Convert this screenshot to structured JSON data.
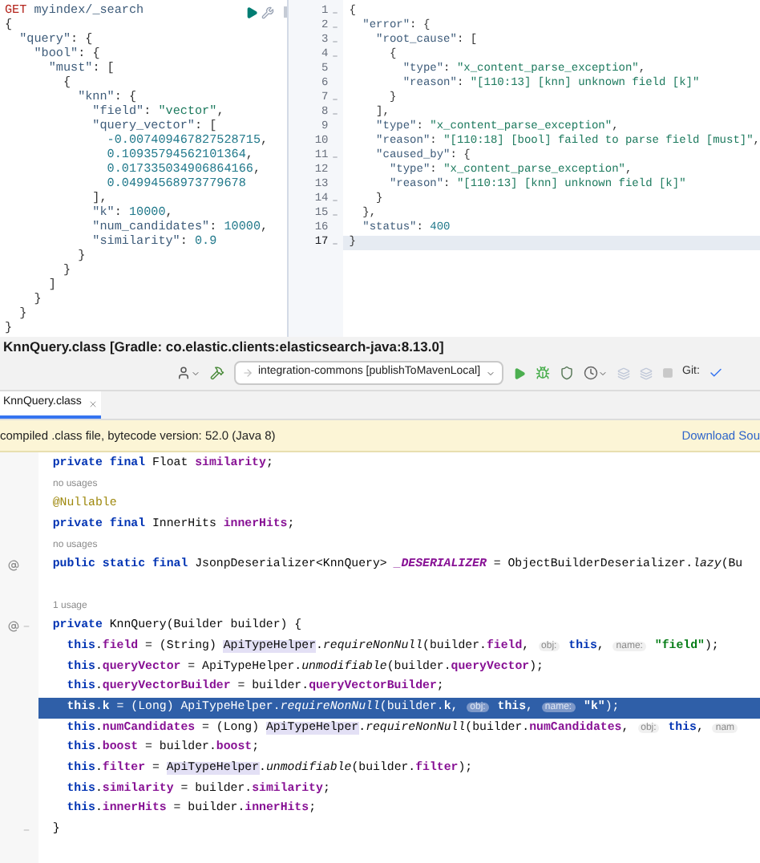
{
  "console": {
    "request": {
      "method": "GET",
      "path": "myindex/_search"
    },
    "request_body": [
      {
        "segments": [
          {
            "text": "{",
            "kind": "punct"
          }
        ]
      },
      {
        "segments": [
          {
            "text": "  \"query\"",
            "kind": "key"
          },
          {
            "text": ": {",
            "kind": "punct"
          }
        ]
      },
      {
        "segments": [
          {
            "text": "    \"bool\"",
            "kind": "key"
          },
          {
            "text": ": {",
            "kind": "punct"
          }
        ]
      },
      {
        "segments": [
          {
            "text": "      \"must\"",
            "kind": "key"
          },
          {
            "text": ": [",
            "kind": "punct"
          }
        ]
      },
      {
        "segments": [
          {
            "text": "        {",
            "kind": "punct"
          }
        ]
      },
      {
        "segments": [
          {
            "text": "          \"knn\"",
            "kind": "key"
          },
          {
            "text": ": {",
            "kind": "punct"
          }
        ]
      },
      {
        "segments": [
          {
            "text": "            \"field\"",
            "kind": "key"
          },
          {
            "text": ": ",
            "kind": "punct"
          },
          {
            "text": "\"vector\"",
            "kind": "string"
          },
          {
            "text": ",",
            "kind": "punct"
          }
        ]
      },
      {
        "segments": [
          {
            "text": "            \"query_vector\"",
            "kind": "key"
          },
          {
            "text": ": [",
            "kind": "punct"
          }
        ]
      },
      {
        "segments": [
          {
            "text": "              -0.007409467827528715",
            "kind": "number"
          },
          {
            "text": ",",
            "kind": "punct"
          }
        ]
      },
      {
        "segments": [
          {
            "text": "              0.10935794562101364",
            "kind": "number"
          },
          {
            "text": ",",
            "kind": "punct"
          }
        ]
      },
      {
        "segments": [
          {
            "text": "              0.017335034906864166",
            "kind": "number"
          },
          {
            "text": ",",
            "kind": "punct"
          }
        ]
      },
      {
        "segments": [
          {
            "text": "              0.04994568973779678",
            "kind": "number"
          }
        ]
      },
      {
        "segments": [
          {
            "text": "            ],",
            "kind": "punct"
          }
        ]
      },
      {
        "segments": [
          {
            "text": "            \"k\"",
            "kind": "key"
          },
          {
            "text": ": ",
            "kind": "punct"
          },
          {
            "text": "10000",
            "kind": "number"
          },
          {
            "text": ",",
            "kind": "punct"
          }
        ]
      },
      {
        "segments": [
          {
            "text": "            \"num_candidates\"",
            "kind": "key"
          },
          {
            "text": ": ",
            "kind": "punct"
          },
          {
            "text": "10000",
            "kind": "number"
          },
          {
            "text": ",",
            "kind": "punct"
          }
        ]
      },
      {
        "segments": [
          {
            "text": "            \"similarity\"",
            "kind": "key"
          },
          {
            "text": ": ",
            "kind": "punct"
          },
          {
            "text": "0.9",
            "kind": "number"
          }
        ]
      },
      {
        "segments": [
          {
            "text": "          }",
            "kind": "punct"
          }
        ]
      },
      {
        "segments": [
          {
            "text": "        }",
            "kind": "punct"
          }
        ]
      },
      {
        "segments": [
          {
            "text": "      ]",
            "kind": "punct"
          }
        ]
      },
      {
        "segments": [
          {
            "text": "    }",
            "kind": "punct"
          }
        ]
      },
      {
        "segments": [
          {
            "text": "  }",
            "kind": "punct"
          }
        ]
      },
      {
        "segments": [
          {
            "text": "}",
            "kind": "punct"
          }
        ]
      }
    ],
    "response": [
      {
        "number": "1",
        "foldable": true,
        "current": false,
        "segments": [
          {
            "text": "{",
            "kind": "punct"
          }
        ]
      },
      {
        "number": "2",
        "foldable": true,
        "current": false,
        "segments": [
          {
            "text": "  \"error\"",
            "kind": "key"
          },
          {
            "text": ": {",
            "kind": "punct"
          }
        ]
      },
      {
        "number": "3",
        "foldable": true,
        "current": false,
        "segments": [
          {
            "text": "    \"root_cause\"",
            "kind": "key"
          },
          {
            "text": ": [",
            "kind": "punct"
          }
        ]
      },
      {
        "number": "4",
        "foldable": true,
        "current": false,
        "segments": [
          {
            "text": "      {",
            "kind": "punct"
          }
        ]
      },
      {
        "number": "5",
        "foldable": false,
        "current": false,
        "segments": [
          {
            "text": "        \"type\"",
            "kind": "key"
          },
          {
            "text": ": ",
            "kind": "punct"
          },
          {
            "text": "\"x_content_parse_exception\"",
            "kind": "string"
          },
          {
            "text": ",",
            "kind": "punct"
          }
        ]
      },
      {
        "number": "6",
        "foldable": false,
        "current": false,
        "segments": [
          {
            "text": "        \"reason\"",
            "kind": "key"
          },
          {
            "text": ": ",
            "kind": "punct"
          },
          {
            "text": "\"[110:13] [knn] unknown field [k]\"",
            "kind": "string"
          }
        ]
      },
      {
        "number": "7",
        "foldable": true,
        "current": false,
        "segments": [
          {
            "text": "      }",
            "kind": "punct"
          }
        ]
      },
      {
        "number": "8",
        "foldable": true,
        "current": false,
        "segments": [
          {
            "text": "    ],",
            "kind": "punct"
          }
        ]
      },
      {
        "number": "9",
        "foldable": false,
        "current": false,
        "segments": [
          {
            "text": "    \"type\"",
            "kind": "key"
          },
          {
            "text": ": ",
            "kind": "punct"
          },
          {
            "text": "\"x_content_parse_exception\"",
            "kind": "string"
          },
          {
            "text": ",",
            "kind": "punct"
          }
        ]
      },
      {
        "number": "10",
        "foldable": false,
        "current": false,
        "segments": [
          {
            "text": "    \"reason\"",
            "kind": "key"
          },
          {
            "text": ": ",
            "kind": "punct"
          },
          {
            "text": "\"[110:18] [bool] failed to parse field [must]\"",
            "kind": "string"
          },
          {
            "text": ",",
            "kind": "punct"
          }
        ]
      },
      {
        "number": "11",
        "foldable": true,
        "current": false,
        "segments": [
          {
            "text": "    \"caused_by\"",
            "kind": "key"
          },
          {
            "text": ": {",
            "kind": "punct"
          }
        ]
      },
      {
        "number": "12",
        "foldable": false,
        "current": false,
        "segments": [
          {
            "text": "      \"type\"",
            "kind": "key"
          },
          {
            "text": ": ",
            "kind": "punct"
          },
          {
            "text": "\"x_content_parse_exception\"",
            "kind": "string"
          },
          {
            "text": ",",
            "kind": "punct"
          }
        ]
      },
      {
        "number": "13",
        "foldable": false,
        "current": false,
        "segments": [
          {
            "text": "      \"reason\"",
            "kind": "key"
          },
          {
            "text": ": ",
            "kind": "punct"
          },
          {
            "text": "\"[110:13] [knn] unknown field [k]\"",
            "kind": "string"
          }
        ]
      },
      {
        "number": "14",
        "foldable": true,
        "current": false,
        "segments": [
          {
            "text": "    }",
            "kind": "punct"
          }
        ]
      },
      {
        "number": "15",
        "foldable": true,
        "current": false,
        "segments": [
          {
            "text": "  },",
            "kind": "punct"
          }
        ]
      },
      {
        "number": "16",
        "foldable": false,
        "current": false,
        "segments": [
          {
            "text": "  \"status\"",
            "kind": "key"
          },
          {
            "text": ": ",
            "kind": "punct"
          },
          {
            "text": "400",
            "kind": "number"
          }
        ]
      },
      {
        "number": "17",
        "foldable": true,
        "current": true,
        "segments": [
          {
            "text": "}",
            "kind": "punct"
          }
        ]
      }
    ]
  },
  "ide": {
    "title": "KnnQuery.class [Gradle: co.elastic.clients:elasticsearch-java:8.13.0]",
    "toolbar": {
      "run_config": "integration-commons [publishToMavenLocal]",
      "vcs_label": "Git:"
    },
    "tabs": [
      {
        "label": "KnnQuery.class",
        "selected": true
      }
    ],
    "banner": {
      "text": "compiled .class file, bytecode version: 52.0 (Java 8)",
      "link": "Download Sou"
    },
    "lines": [
      {
        "kind": "code",
        "current": false,
        "gutter_icon": false,
        "foldable": false,
        "segments": [
          {
            "text": "  private final",
            "kind": "keyword"
          },
          {
            "text": " Float ",
            "kind": "plain"
          },
          {
            "text": "similarity",
            "kind": "field"
          },
          {
            "text": ";",
            "kind": "plain"
          }
        ]
      },
      {
        "kind": "usage",
        "current": false,
        "gutter_icon": false,
        "foldable": false,
        "text": "no usages"
      },
      {
        "kind": "code",
        "current": false,
        "gutter_icon": false,
        "foldable": false,
        "segments": [
          {
            "text": "  @Nullable",
            "kind": "annotation"
          }
        ]
      },
      {
        "kind": "code",
        "current": false,
        "gutter_icon": false,
        "foldable": false,
        "segments": [
          {
            "text": "  private final",
            "kind": "keyword"
          },
          {
            "text": " InnerHits ",
            "kind": "plain"
          },
          {
            "text": "innerHits",
            "kind": "field"
          },
          {
            "text": ";",
            "kind": "plain"
          }
        ]
      },
      {
        "kind": "usage",
        "current": false,
        "gutter_icon": false,
        "foldable": false,
        "text": "no usages"
      },
      {
        "kind": "code",
        "current": false,
        "gutter_icon": true,
        "foldable": false,
        "segments": [
          {
            "text": "  public static final",
            "kind": "keyword"
          },
          {
            "text": " JsonpDeserializer<KnnQuery> ",
            "kind": "plain"
          },
          {
            "text": "_DESERIALIZER",
            "kind": "static_field"
          },
          {
            "text": " = ObjectBuilderDeserializer.",
            "kind": "plain"
          },
          {
            "text": "lazy",
            "kind": "static_call"
          },
          {
            "text": "(Bu",
            "kind": "plain"
          }
        ]
      },
      {
        "kind": "blank",
        "current": false,
        "gutter_icon": false,
        "foldable": false
      },
      {
        "kind": "usage",
        "current": false,
        "gutter_icon": false,
        "foldable": false,
        "text": "1 usage"
      },
      {
        "kind": "code",
        "current": false,
        "gutter_icon": true,
        "foldable": true,
        "segments": [
          {
            "text": "  private",
            "kind": "keyword"
          },
          {
            "text": " KnnQuery(Builder builder) {",
            "kind": "plain"
          }
        ]
      },
      {
        "kind": "code",
        "current": false,
        "gutter_icon": false,
        "foldable": false,
        "segments": [
          {
            "text": "    this",
            "kind": "keyword"
          },
          {
            "text": ".",
            "kind": "plain"
          },
          {
            "text": "field",
            "kind": "field"
          },
          {
            "text": " = (String) ",
            "kind": "plain"
          },
          {
            "text": "ApiTypeHelper",
            "kind": "ref"
          },
          {
            "text": ".",
            "kind": "plain"
          },
          {
            "text": "requireNonNull",
            "kind": "static_call"
          },
          {
            "text": "(builder.",
            "kind": "plain"
          },
          {
            "text": "field",
            "kind": "field"
          },
          {
            "text": ", ",
            "kind": "plain"
          },
          {
            "text": "obj:",
            "kind": "hint"
          },
          {
            "text": " this",
            "kind": "keyword"
          },
          {
            "text": ", ",
            "kind": "plain"
          },
          {
            "text": "name:",
            "kind": "hint"
          },
          {
            "text": " \"field\"",
            "kind": "string"
          },
          {
            "text": ");",
            "kind": "plain"
          }
        ]
      },
      {
        "kind": "code",
        "current": false,
        "gutter_icon": false,
        "foldable": false,
        "segments": [
          {
            "text": "    this",
            "kind": "keyword"
          },
          {
            "text": ".",
            "kind": "plain"
          },
          {
            "text": "queryVector",
            "kind": "field"
          },
          {
            "text": " = ApiTypeHelper.",
            "kind": "plain"
          },
          {
            "text": "unmodifiable",
            "kind": "static_call"
          },
          {
            "text": "(builder.",
            "kind": "plain"
          },
          {
            "text": "queryVector",
            "kind": "field"
          },
          {
            "text": ");",
            "kind": "plain"
          }
        ]
      },
      {
        "kind": "code",
        "current": false,
        "gutter_icon": false,
        "foldable": false,
        "segments": [
          {
            "text": "    this",
            "kind": "keyword"
          },
          {
            "text": ".",
            "kind": "plain"
          },
          {
            "text": "queryVectorBuilder",
            "kind": "field"
          },
          {
            "text": " = builder.",
            "kind": "plain"
          },
          {
            "text": "queryVectorBuilder",
            "kind": "field"
          },
          {
            "text": ";",
            "kind": "plain"
          }
        ]
      },
      {
        "kind": "code",
        "current": true,
        "gutter_icon": false,
        "foldable": false,
        "segments": [
          {
            "text": "    this",
            "kind": "keyword"
          },
          {
            "text": ".",
            "kind": "plain"
          },
          {
            "text": "k",
            "kind": "field"
          },
          {
            "text": " = (Long) ApiTypeHelper.",
            "kind": "plain"
          },
          {
            "text": "requireNonNull",
            "kind": "static_call"
          },
          {
            "text": "(builder.",
            "kind": "plain"
          },
          {
            "text": "k",
            "kind": "field"
          },
          {
            "text": ", ",
            "kind": "plain"
          },
          {
            "text": "obj:",
            "kind": "hint"
          },
          {
            "text": " this",
            "kind": "keyword"
          },
          {
            "text": ", ",
            "kind": "plain"
          },
          {
            "text": "name:",
            "kind": "hint"
          },
          {
            "text": " \"k\"",
            "kind": "string"
          },
          {
            "text": ");",
            "kind": "plain"
          }
        ]
      },
      {
        "kind": "code",
        "current": false,
        "gutter_icon": false,
        "foldable": false,
        "segments": [
          {
            "text": "    this",
            "kind": "keyword"
          },
          {
            "text": ".",
            "kind": "plain"
          },
          {
            "text": "numCandidates",
            "kind": "field"
          },
          {
            "text": " = (Long) ",
            "kind": "plain"
          },
          {
            "text": "ApiTypeHelper",
            "kind": "ref"
          },
          {
            "text": ".",
            "kind": "plain"
          },
          {
            "text": "requireNonNull",
            "kind": "static_call"
          },
          {
            "text": "(builder.",
            "kind": "plain"
          },
          {
            "text": "numCandidates",
            "kind": "field"
          },
          {
            "text": ", ",
            "kind": "plain"
          },
          {
            "text": "obj:",
            "kind": "hint"
          },
          {
            "text": " this",
            "kind": "keyword"
          },
          {
            "text": ", ",
            "kind": "plain"
          },
          {
            "text": "nam",
            "kind": "hint"
          }
        ]
      },
      {
        "kind": "code",
        "current": false,
        "gutter_icon": false,
        "foldable": false,
        "segments": [
          {
            "text": "    this",
            "kind": "keyword"
          },
          {
            "text": ".",
            "kind": "plain"
          },
          {
            "text": "boost",
            "kind": "field"
          },
          {
            "text": " = builder.",
            "kind": "plain"
          },
          {
            "text": "boost",
            "kind": "field"
          },
          {
            "text": ";",
            "kind": "plain"
          }
        ]
      },
      {
        "kind": "code",
        "current": false,
        "gutter_icon": false,
        "foldable": false,
        "segments": [
          {
            "text": "    this",
            "kind": "keyword"
          },
          {
            "text": ".",
            "kind": "plain"
          },
          {
            "text": "filter",
            "kind": "field"
          },
          {
            "text": " = ",
            "kind": "plain"
          },
          {
            "text": "ApiTypeHelper",
            "kind": "ref"
          },
          {
            "text": ".",
            "kind": "plain"
          },
          {
            "text": "unmodifiable",
            "kind": "static_call"
          },
          {
            "text": "(builder.",
            "kind": "plain"
          },
          {
            "text": "filter",
            "kind": "field"
          },
          {
            "text": ");",
            "kind": "plain"
          }
        ]
      },
      {
        "kind": "code",
        "current": false,
        "gutter_icon": false,
        "foldable": false,
        "segments": [
          {
            "text": "    this",
            "kind": "keyword"
          },
          {
            "text": ".",
            "kind": "plain"
          },
          {
            "text": "similarity",
            "kind": "field"
          },
          {
            "text": " = builder.",
            "kind": "plain"
          },
          {
            "text": "similarity",
            "kind": "field"
          },
          {
            "text": ";",
            "kind": "plain"
          }
        ]
      },
      {
        "kind": "code",
        "current": false,
        "gutter_icon": false,
        "foldable": false,
        "segments": [
          {
            "text": "    this",
            "kind": "keyword"
          },
          {
            "text": ".",
            "kind": "plain"
          },
          {
            "text": "innerHits",
            "kind": "field"
          },
          {
            "text": " = builder.",
            "kind": "plain"
          },
          {
            "text": "innerHits",
            "kind": "field"
          },
          {
            "text": ";",
            "kind": "plain"
          }
        ]
      },
      {
        "kind": "code",
        "current": false,
        "gutter_icon": false,
        "foldable": true,
        "segments": [
          {
            "text": "  }",
            "kind": "plain"
          }
        ]
      }
    ]
  }
}
